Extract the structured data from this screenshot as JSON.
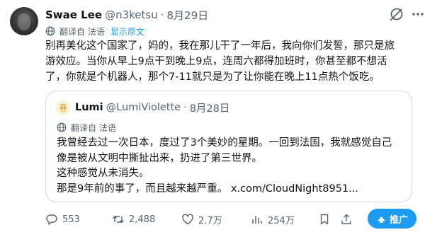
{
  "tweet": {
    "author_name": "Swae Lee",
    "author_handle": "@n3ketsu",
    "separator": "·",
    "date": "8月29日",
    "translated_from": "翻译自 法语",
    "show_original": "显示原文",
    "text_lines": [
      "别再美化这个国家了，妈的，我在那儿干了一年后，我向你们发誓，那只是旅",
      "游效应。当你从早上9点干到晚上9点，连周六都得加班时，你甚至都不想活",
      "了，你就是个机器人，那个7-11就只是为了让你能在晚上11点热个饭吃。"
    ]
  },
  "quoted_tweet": {
    "author_name": "Lumi",
    "author_handle": "@LumiViolette",
    "separator": "·",
    "date": "8月28日",
    "translated_from": "翻译自 法语",
    "text_lines": [
      "我曾经去过一次日本，度过了3个美妙的星期。一回到法国，我就感觉自己",
      "像是被从文明中撕扯出来，扔进了第三世界。",
      "这种感觉从未消失。",
      "那是9年前的事了，而且越来越严重。  x.com/CloudNight8951..."
    ]
  },
  "actions": {
    "reply_count": "553",
    "retweet_count": "2,488",
    "like_count": "2.7万",
    "view_count": "254万",
    "promote_label": "推广"
  },
  "colors": {
    "accent": "#1d9bf0",
    "secondary_text": "#536471",
    "border": "#cfd9de"
  }
}
